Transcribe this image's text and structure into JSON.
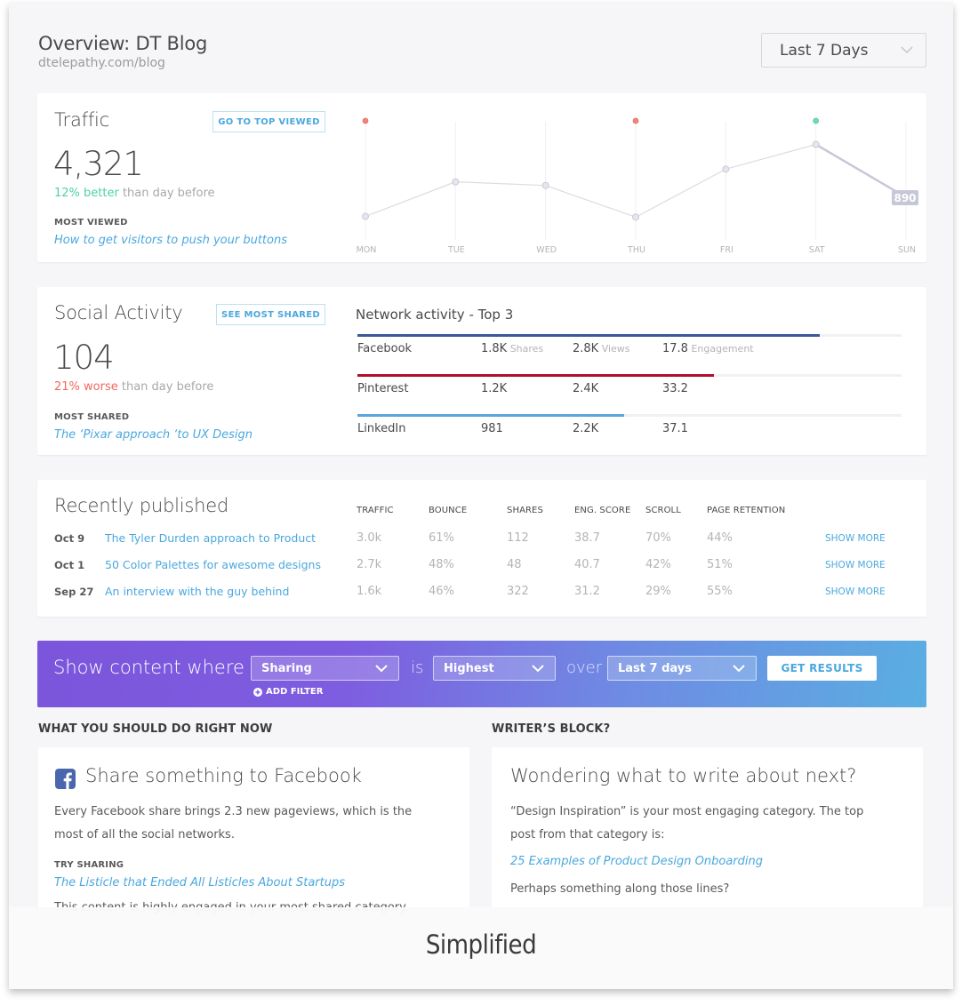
{
  "header": {
    "title": "Overview: DT Blog",
    "subtitle": "dtelepathy.com/blog",
    "range_select": {
      "value": "Last 7 Days",
      "icon": "chevron-down-icon"
    }
  },
  "traffic": {
    "title": "Traffic",
    "button_label": "GO TO TOP VIEWED",
    "total": "4,321",
    "delta_value": "12% better",
    "delta_suffix": " than day before",
    "most_viewed_label": "MOST VIEWED",
    "most_viewed_link": "How to get visitors to push your buttons"
  },
  "chart_data": {
    "type": "line",
    "title": "",
    "categories": [
      "MON",
      "TUE",
      "WED",
      "THU",
      "FRI",
      "SAT",
      "SUN"
    ],
    "values": [
      490,
      1210,
      1135,
      475,
      1475,
      1990,
      890
    ],
    "value_label": {
      "index": 6,
      "text": "890"
    },
    "markers": [
      {
        "index": 0,
        "status": "negative"
      },
      {
        "index": 3,
        "status": "negative"
      },
      {
        "index": 5,
        "status": "positive"
      }
    ],
    "ylim": [
      0,
      2500
    ],
    "grid": "vertical",
    "xlabel": "",
    "ylabel": "",
    "colors": {
      "line": "#dcdce2",
      "point": "#e6e6ee",
      "highlight": "#c6c8d8",
      "negative": "#f0857a",
      "positive": "#6ddcb2"
    }
  },
  "social": {
    "title": "Social Activity",
    "button_label": "SEE MOST SHARED",
    "total": "104",
    "delta_value": "21% worse",
    "delta_suffix": " than day before",
    "most_shared_label": "MOST SHARED",
    "most_shared_link": "The ‘Pixar approach ‘to UX Design",
    "network_title": "Network activity - Top 3",
    "networks": [
      {
        "name": "Facebook",
        "shares": "1.8K",
        "shares_unit": " Shares",
        "views": "2.8K",
        "views_unit": " Views",
        "engagement": "17.8",
        "engagement_unit": " Engagement",
        "share_fraction": 0.85,
        "color": "#3b5998"
      },
      {
        "name": "Pinterest",
        "shares": "1.2K",
        "shares_unit": "",
        "views": "2.4K",
        "views_unit": "",
        "engagement": "33.2",
        "engagement_unit": "",
        "share_fraction": 0.655,
        "color": "#b0102b"
      },
      {
        "name": "LinkedIn",
        "shares": "981",
        "shares_unit": "",
        "views": "2.2K",
        "views_unit": "",
        "engagement": "37.1",
        "engagement_unit": "",
        "share_fraction": 0.49,
        "color": "#5ba4dc"
      }
    ]
  },
  "recent": {
    "title": "Recently published",
    "columns": [
      "TRAFFIC",
      "BOUNCE",
      "SHARES",
      "ENG. SCORE",
      "SCROLL",
      "PAGE RETENTION"
    ],
    "show_more_label": "SHOW MORE",
    "rows": [
      {
        "date": "Oct 9",
        "title": "The Tyler Durden approach to Product",
        "values": [
          "3.0k",
          "61%",
          "112",
          "38.7",
          "70%",
          "44%"
        ]
      },
      {
        "date": "Oct 1",
        "title": "50 Color Palettes for awesome designs",
        "values": [
          "2.7k",
          "48%",
          "48",
          "40.7",
          "42%",
          "51%"
        ]
      },
      {
        "date": "Sep 27",
        "title": "An interview with the guy behind",
        "values": [
          "1.6k",
          "46%",
          "322",
          "31.2",
          "29%",
          "55%"
        ]
      }
    ]
  },
  "filter": {
    "label": "Show content where",
    "metric": "Sharing",
    "is_word": "is",
    "condition": "Highest",
    "over_word": "over",
    "period": "Last 7 days",
    "add_filter_label": "ADD FILTER",
    "submit_label": "GET RESULTS"
  },
  "actions": {
    "section_label": "WHAT YOU SHOULD DO RIGHT NOW",
    "card_title": "Share something to Facebook",
    "card_icon": "facebook-icon",
    "body_line1": "Every Facebook share brings 2.3 new pageviews, which is the",
    "body_line2": "most of all the social networks.",
    "try_label": "TRY SHARING",
    "try_link": "The Listicle that Ended All Listicles About Startups",
    "note": "This content is highly engaged in your most shared category."
  },
  "writers_block": {
    "section_label": "WRITER’S BLOCK?",
    "card_title": "Wondering what to write about next?",
    "body_line1": "“Design Inspiration” is your most engaging category. The top",
    "body_line2": "post from that category is:",
    "link": "25 Examples of Product Design Onboarding",
    "closing": "Perhaps something along those lines?"
  },
  "caption": "Simplified"
}
